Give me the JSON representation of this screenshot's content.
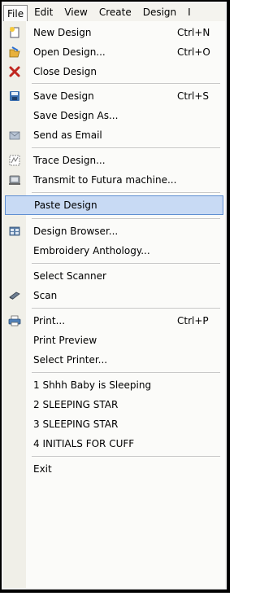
{
  "menubar": {
    "items": [
      "File",
      "Edit",
      "View",
      "Create",
      "Design",
      "I"
    ],
    "active": "File"
  },
  "menu": {
    "items": [
      {
        "label": "New Design",
        "shortcut": "Ctrl+N",
        "icon": "new-design-icon"
      },
      {
        "label": "Open Design...",
        "shortcut": "Ctrl+O",
        "icon": "open-design-icon"
      },
      {
        "label": "Close Design",
        "shortcut": "",
        "icon": "close-design-icon"
      },
      {
        "label": "Save Design",
        "shortcut": "Ctrl+S",
        "icon": "save-design-icon"
      },
      {
        "label": "Save Design As...",
        "shortcut": "",
        "icon": ""
      },
      {
        "label": "Send as Email",
        "shortcut": "",
        "icon": "email-icon"
      },
      {
        "label": "Trace Design...",
        "shortcut": "",
        "icon": "trace-design-icon"
      },
      {
        "label": "Transmit to Futura machine...",
        "shortcut": "",
        "icon": "transmit-icon"
      },
      {
        "label": "Paste Design",
        "shortcut": "",
        "icon": ""
      },
      {
        "label": "Design Browser...",
        "shortcut": "",
        "icon": "design-browser-icon"
      },
      {
        "label": "Embroidery Anthology...",
        "shortcut": "",
        "icon": ""
      },
      {
        "label": "Select Scanner",
        "shortcut": "",
        "icon": ""
      },
      {
        "label": "Scan",
        "shortcut": "",
        "icon": "scan-icon"
      },
      {
        "label": "Print...",
        "shortcut": "Ctrl+P",
        "icon": "printer-icon"
      },
      {
        "label": "Print Preview",
        "shortcut": "",
        "icon": ""
      },
      {
        "label": "Select Printer...",
        "shortcut": "",
        "icon": ""
      },
      {
        "label": "1 Shhh Baby is Sleeping",
        "shortcut": "",
        "icon": ""
      },
      {
        "label": "2 SLEEPING STAR",
        "shortcut": "",
        "icon": ""
      },
      {
        "label": "3 SLEEPING STAR",
        "shortcut": "",
        "icon": ""
      },
      {
        "label": "4 INITIALS FOR CUFF",
        "shortcut": "",
        "icon": ""
      },
      {
        "label": "Exit",
        "shortcut": "",
        "icon": ""
      }
    ],
    "highlighted": "Paste Design"
  },
  "colors": {
    "highlight_bg": "#c8daf4",
    "highlight_border": "#5f8fd2",
    "icon_column": "#f0efe8"
  }
}
